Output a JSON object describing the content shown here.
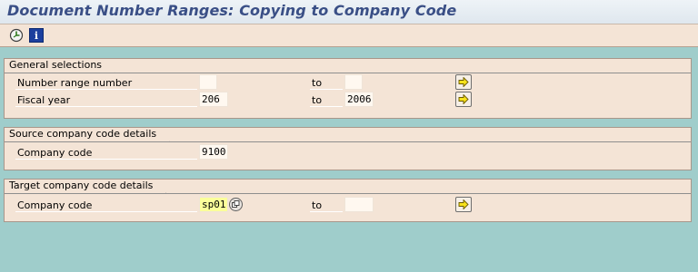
{
  "window": {
    "title": "Document Number Ranges: Copying to Company Code"
  },
  "toolbar": {
    "execute_icon": "execute-clock-icon",
    "info_icon": "info-icon",
    "info_glyph": "i"
  },
  "general_selections": {
    "title": "General selections",
    "number_range": {
      "label": "Number range number",
      "from": "",
      "to_label": "to",
      "to": ""
    },
    "fiscal_year": {
      "label": "Fiscal year",
      "from": "206",
      "to_label": "to",
      "to": "2006"
    }
  },
  "source": {
    "title": "Source company code details",
    "company_code": {
      "label": "Company code",
      "value": "9100"
    }
  },
  "target": {
    "title": "Target company code details",
    "company_code": {
      "label": "Company code",
      "value": "sp01",
      "to_label": "to",
      "to": ""
    }
  },
  "colors": {
    "background": "#9fcdcb",
    "panel": "#f4e4d6",
    "title": "#3a4f86",
    "highlight_field": "#fbff9a",
    "arrow_yellow": "#f7e21a"
  }
}
